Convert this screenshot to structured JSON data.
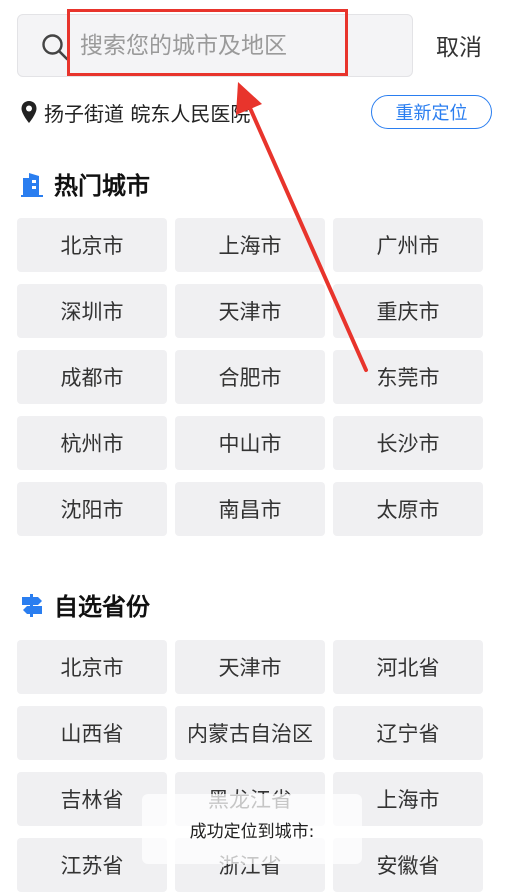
{
  "search": {
    "placeholder": "搜索您的城市及地区",
    "cancel_label": "取消"
  },
  "location": {
    "current": "扬子街道 皖东人民医院",
    "relocate_label": "重新定位"
  },
  "hot_cities": {
    "title": "热门城市",
    "items": [
      "北京市",
      "上海市",
      "广州市",
      "深圳市",
      "天津市",
      "重庆市",
      "成都市",
      "合肥市",
      "东莞市",
      "杭州市",
      "中山市",
      "长沙市",
      "沈阳市",
      "南昌市",
      "太原市"
    ]
  },
  "provinces": {
    "title": "自选省份",
    "items": [
      "北京市",
      "天津市",
      "河北省",
      "山西省",
      "内蒙古自治区",
      "辽宁省",
      "吉林省",
      "黑龙江省",
      "上海市",
      "江苏省",
      "浙江省",
      "安徽省"
    ]
  },
  "toast": {
    "text": "成功定位到城市:"
  },
  "colors": {
    "accent": "#2a7ef0",
    "annotation": "#e8342c"
  }
}
